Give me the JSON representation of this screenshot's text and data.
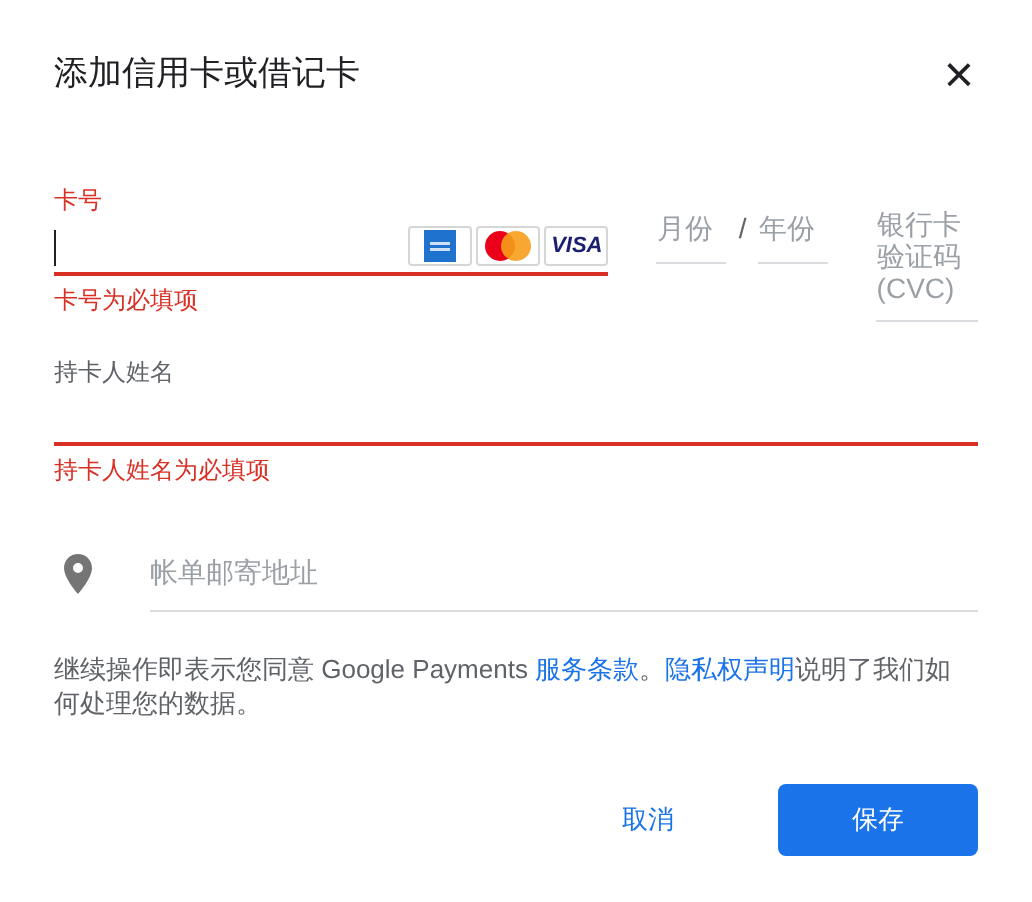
{
  "dialog": {
    "title": "添加信用卡或借记卡",
    "close": "×"
  },
  "card_number": {
    "label": "卡号",
    "invalid": true,
    "error": "卡号为必填项",
    "brands": [
      {
        "kind": "amex"
      },
      {
        "kind": "mastercard"
      },
      {
        "kind": "visa",
        "text": "VISA"
      }
    ]
  },
  "expiry": {
    "month_placeholder": "月份",
    "separator": "/",
    "year_placeholder": "年份"
  },
  "cvc": {
    "placeholder": "银行卡验证码(CVC)"
  },
  "cardholder": {
    "label": "持卡人姓名",
    "invalid": true,
    "error": "持卡人姓名为必填项"
  },
  "address": {
    "placeholder": "帐单邮寄地址"
  },
  "terms": [
    {
      "kind": "text",
      "text": "继续操作即表示您同意 Google Payments "
    },
    {
      "kind": "link",
      "text": "服务条款"
    },
    {
      "kind": "text",
      "text": "。"
    },
    {
      "kind": "link",
      "text": "隐私权声明"
    },
    {
      "kind": "text",
      "text": "说明了我们如何处理您的数据。"
    }
  ],
  "buttons": {
    "cancel": "取消",
    "save": "保存"
  }
}
